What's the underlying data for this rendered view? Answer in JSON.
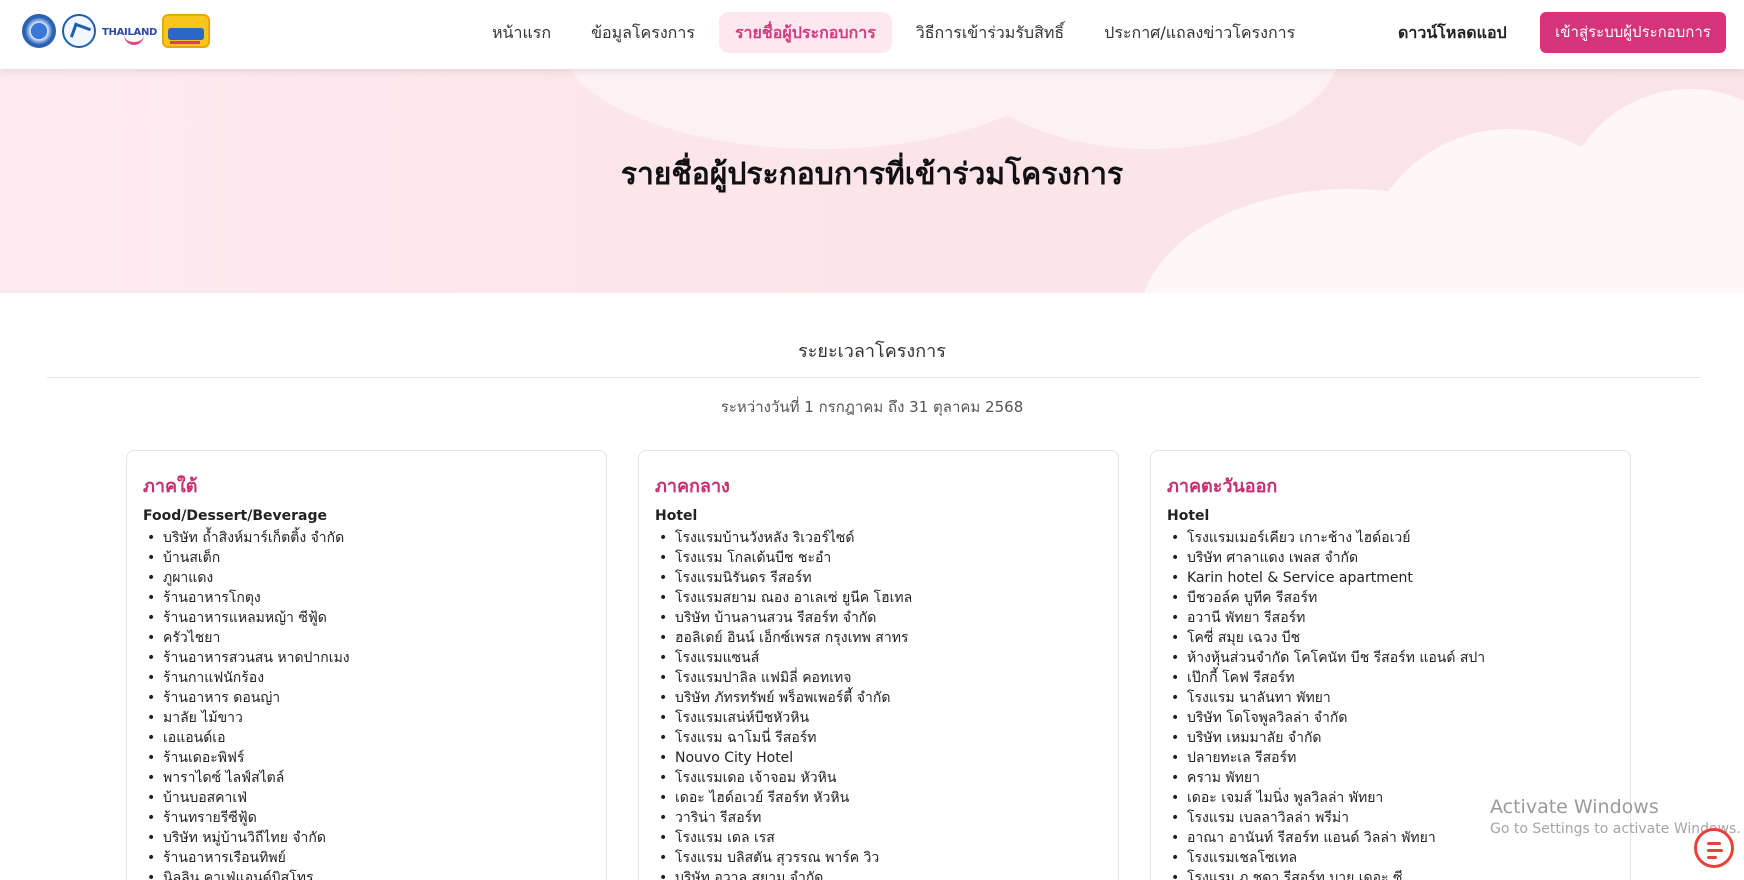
{
  "header": {
    "nav": [
      {
        "label": "หน้าแรก",
        "active": false
      },
      {
        "label": "ข้อมูลโครงการ",
        "active": false
      },
      {
        "label": "รายชื่อผู้ประกอบการ",
        "active": true
      },
      {
        "label": "วิธีการเข้าร่วมรับสิทธิ์",
        "active": false
      },
      {
        "label": "ประกาศ/แถลงข่าวโครงการ",
        "active": false
      }
    ],
    "download_label": "ดาวน์โหลดแอป",
    "login_label": "เข้าสู่ระบบผู้ประกอบการ",
    "logo_text": "THAILAND",
    "accent_color": "#d6337a"
  },
  "hero": {
    "title": "รายชื่อผู้ประกอบการที่เข้าร่วมโครงการ"
  },
  "period": {
    "label": "ระยะเวลาโครงการ",
    "range": "ระหว่างวันที่ 1 กรกฎาคม ถึง 31 ตุลาคม 2568"
  },
  "regions": [
    {
      "name": "ภาคใต้",
      "category": "Food/Dessert/Beverage",
      "items": [
        "บริษัท ถ้ำสิงห์มาร์เก็ตติ้ง จำกัด",
        "บ้านสเต็ก",
        "ภูผาแดง",
        "ร้านอาหารโกตุง",
        "ร้านอาหารแหลมหญ้า ซีฟู้ด",
        "ครัวไชยา",
        "ร้านอาหารสวนสน หาดปากเมง",
        "ร้านกาแฟนักร้อง",
        "ร้านอาหาร ดอนญ่า",
        "มาลัย ไม้ขาว",
        "เอแอนด์เอ",
        "ร้านเดอะพิฟร์",
        "พาราไดซ์ ไลฟ์สไตล์",
        "บ้านบอสคาเฟ่",
        "ร้านทรายรีซีฟู้ด",
        "บริษัท หมู่บ้านวิถีไทย จำกัด",
        "ร้านอาหารเรือนทิพย์",
        "นิลลิน คาเฟ่แอนด์บิสโทร"
      ]
    },
    {
      "name": "ภาคกลาง",
      "category": "Hotel",
      "items": [
        "โรงแรมบ้านวังหลัง ริเวอร์ไซด์",
        "โรงแรม โกลเด้นบีช ชะอำ",
        "โรงแรมนิรันดร รีสอร์ท",
        "โรงแรมสยาม ณอง อาเลเซ่ ยูนีค โฮเทล",
        "บริษัท บ้านลานสวน รีสอร์ท จำกัด",
        "ฮอลิเดย์ อินน์ เอ็กซ์เพรส กรุงเทพ สาทร",
        "โรงแรมแซนส์",
        "โรงแรมปาลิล แฟมิลี่ คอทเทจ",
        "บริษัท ภัทรทรัพย์ พร็อพเพอร์ตี้ จำกัด",
        "โรงแรมเสน่ห์บีชหัวหิน",
        "โรงแรม ฉาโมนี่ รีสอร์ท",
        "Nouvo City Hotel",
        "โรงแรมเดอ เจ้าจอม หัวหิน",
        "เดอะ ไฮด์อเวย์ รีสอร์ท หัวหิน",
        "วาริน่า รีสอร์ท",
        "โรงแรม เดล เรส",
        "โรงแรม บลิสตัน สุวรรณ พาร์ค วิว",
        "บริษัท อวาล สยาม จำกัด"
      ]
    },
    {
      "name": "ภาคตะวันออก",
      "category": "Hotel",
      "items": [
        "โรงแรมเมอร์เคียว เกาะช้าง ไฮด์อเวย์",
        "บริษัท ศาลาแดง เพลส จำกัด",
        "Karin hotel & Service apartment",
        "บีชวอล์ค บูทีค รีสอร์ท",
        "อวานี พัทยา รีสอร์ท",
        "โคซี่ สมุย เฉวง บีช",
        "ห้างหุ้นส่วนจำกัด โคโคนัท บีช รีสอร์ท แอนด์ สปา",
        "เป๊กกี้ โคฟ รีสอร์ท",
        "โรงแรม นาลันทา พัทยา",
        "บริษัท โดโจพูลวิลล่า จำกัด",
        "บริษัท เหมมาลัย จำกัด",
        "ปลายทะเล รีสอร์ท",
        "คราม พัทยา",
        "เดอะ เจมส์ ไมนิ่ง พูลวิลล่า พัทยา",
        "โรงแรม เบลลาวิลล่า พรีม่า",
        "อาณา อานันท์ รีสอร์ท แอนด์ วิลล่า พัทยา",
        "โรงแรมเชลโซเทล",
        "โรงแรม ภ ชุดา รีสอร์ท บาย เดอะ ซี"
      ]
    }
  ],
  "watermark": {
    "title": "Activate Windows",
    "subtitle": "Go to Settings to activate Windows."
  }
}
